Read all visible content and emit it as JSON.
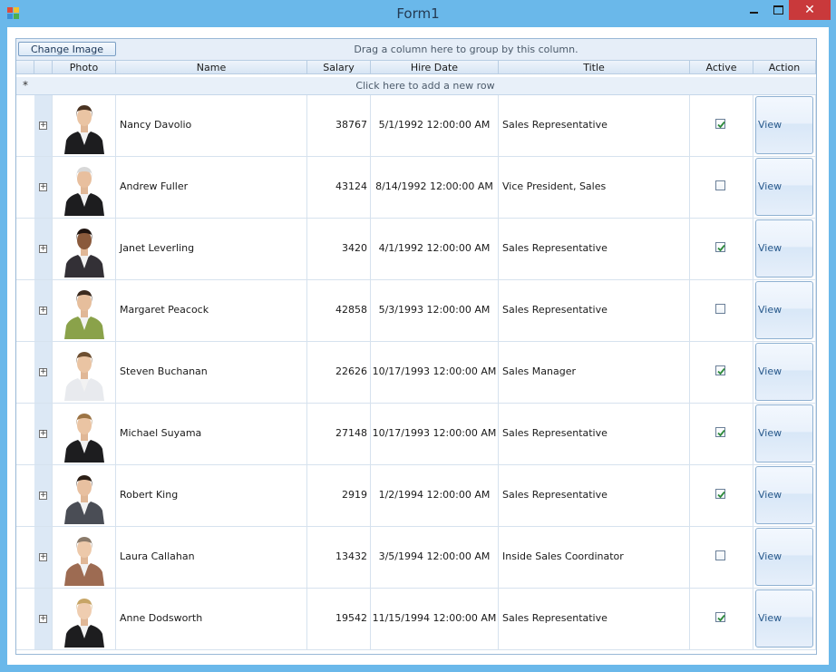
{
  "window": {
    "title": "Form1",
    "close_glyph": "✕"
  },
  "toolbar": {
    "change_image_label": "Change Image",
    "group_hint": "Drag a column here to group by this column."
  },
  "columns": {
    "photo": "Photo",
    "name": "Name",
    "salary": "Salary",
    "hire_date": "Hire Date",
    "title": "Title",
    "active": "Active",
    "action": "Action"
  },
  "new_row": {
    "marker": "*",
    "text": "Click here to add a new row"
  },
  "rows": [
    {
      "name": "Nancy Davolio",
      "salary": "38767",
      "hire_date": "5/1/1992 12:00:00 AM",
      "title": "Sales Representative",
      "active": true,
      "action": "View",
      "expand": "+"
    },
    {
      "name": "Andrew Fuller",
      "salary": "43124",
      "hire_date": "8/14/1992 12:00:00 AM",
      "title": "Vice President, Sales",
      "active": false,
      "action": "View",
      "expand": "+"
    },
    {
      "name": "Janet Leverling",
      "salary": "3420",
      "hire_date": "4/1/1992 12:00:00 AM",
      "title": "Sales Representative",
      "active": true,
      "action": "View",
      "expand": "+"
    },
    {
      "name": "Margaret Peacock",
      "salary": "42858",
      "hire_date": "5/3/1993 12:00:00 AM",
      "title": "Sales Representative",
      "active": false,
      "action": "View",
      "expand": "+"
    },
    {
      "name": "Steven Buchanan",
      "salary": "22626",
      "hire_date": "10/17/1993 12:00:00 AM",
      "title": "Sales Manager",
      "active": true,
      "action": "View",
      "expand": "+"
    },
    {
      "name": "Michael Suyama",
      "salary": "27148",
      "hire_date": "10/17/1993 12:00:00 AM",
      "title": "Sales Representative",
      "active": true,
      "action": "View",
      "expand": "+"
    },
    {
      "name": "Robert King",
      "salary": "2919",
      "hire_date": "1/2/1994 12:00:00 AM",
      "title": "Sales Representative",
      "active": true,
      "action": "View",
      "expand": "+"
    },
    {
      "name": "Laura Callahan",
      "salary": "13432",
      "hire_date": "3/5/1994 12:00:00 AM",
      "title": "Inside Sales Coordinator",
      "active": false,
      "action": "View",
      "expand": "+"
    },
    {
      "name": "Anne Dodsworth",
      "salary": "19542",
      "hire_date": "11/15/1994 12:00:00 AM",
      "title": "Sales Representative",
      "active": true,
      "action": "View",
      "expand": "+"
    }
  ],
  "colors": {
    "accent": "#6ab8ea",
    "close": "#c9393b",
    "check": "#2e8b3a"
  }
}
